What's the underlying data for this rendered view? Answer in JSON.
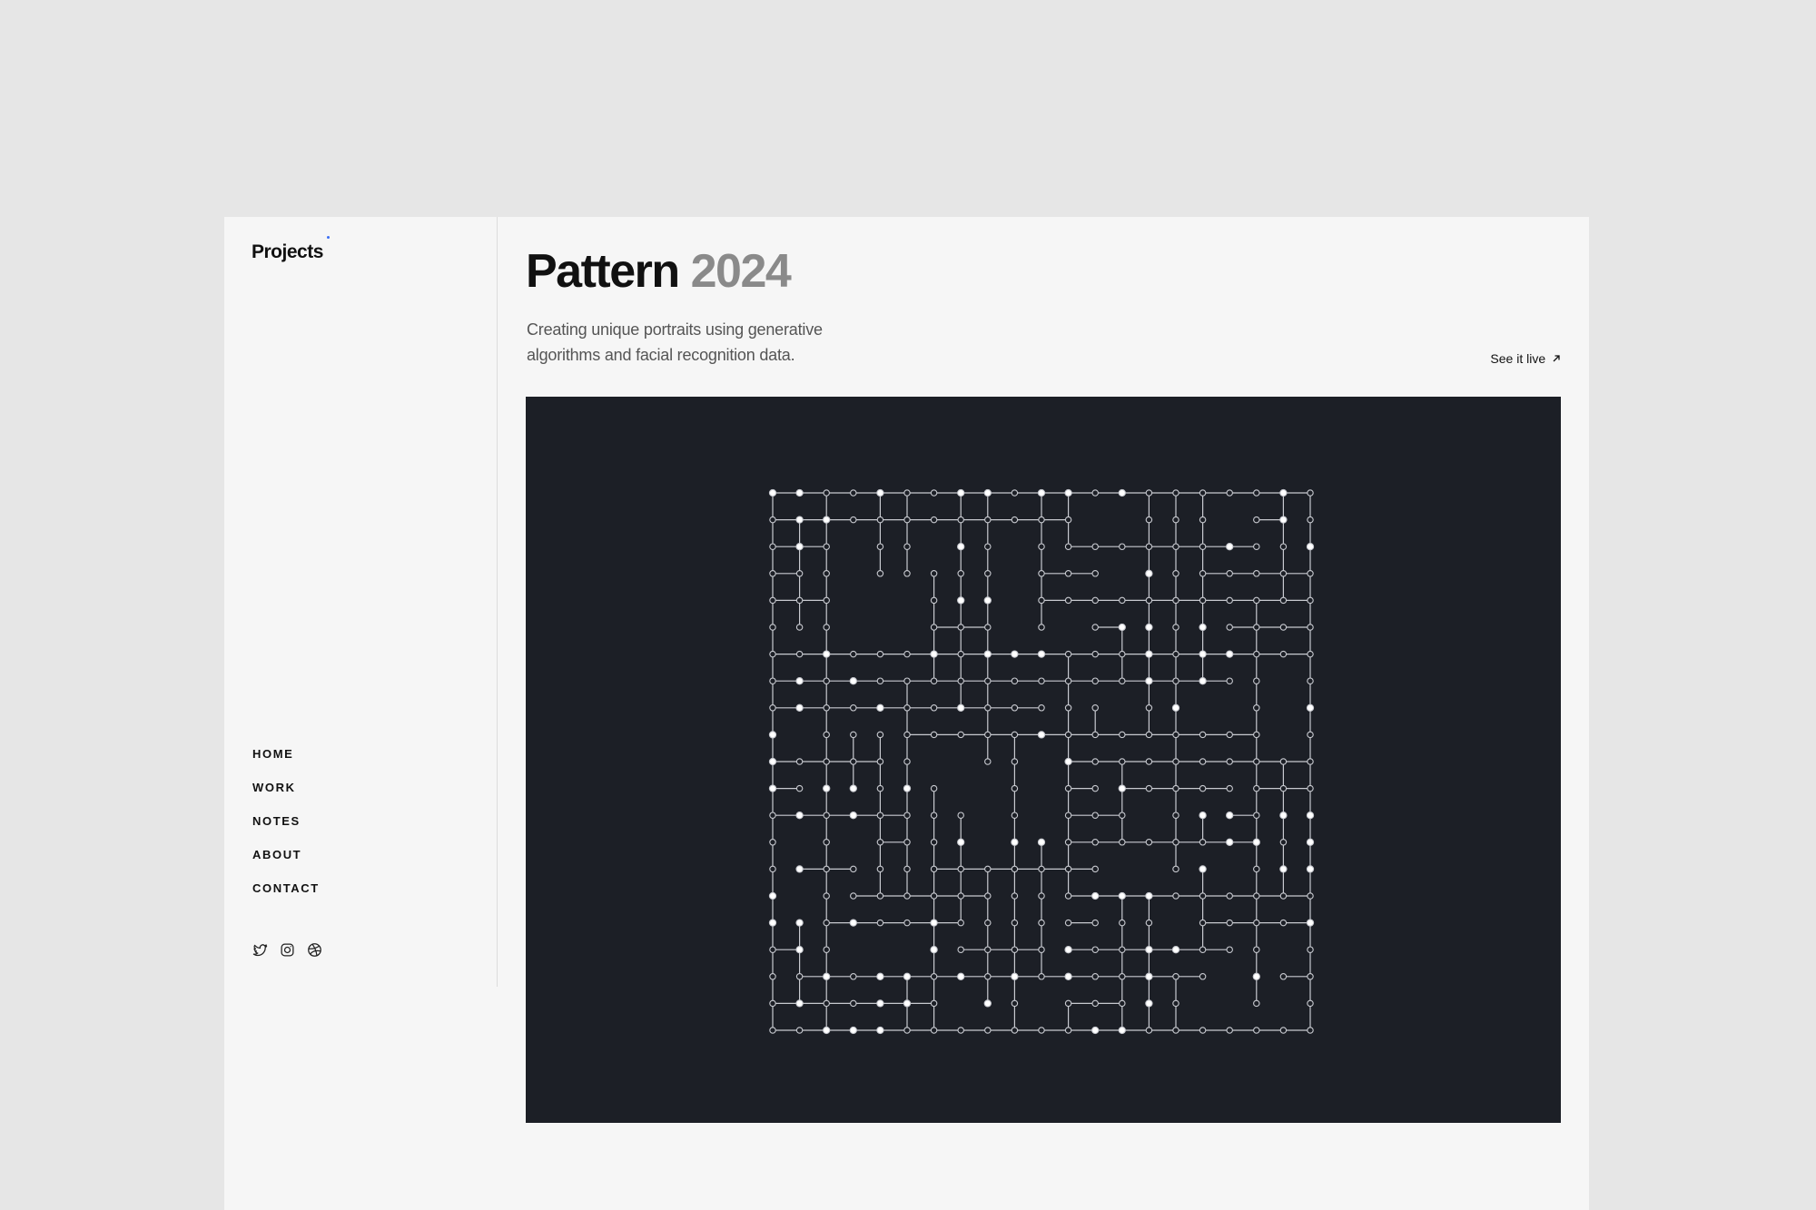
{
  "sidebar": {
    "brand": "Projects",
    "nav": [
      {
        "label": "HOME",
        "name": "nav-home"
      },
      {
        "label": "WORK",
        "name": "nav-work"
      },
      {
        "label": "NOTES",
        "name": "nav-notes"
      },
      {
        "label": "ABOUT",
        "name": "nav-about"
      },
      {
        "label": "CONTACT",
        "name": "nav-contact"
      }
    ],
    "social_icons": [
      "twitter-icon",
      "instagram-icon",
      "dribbble-icon"
    ]
  },
  "project": {
    "title": "Pattern",
    "year": "2024",
    "description": "Creating unique portraits using generative algorithms and facial recognition data.",
    "live_link": "See it live",
    "live_icon": "arrow-up-right-icon"
  },
  "colors": {
    "page_background": "#e6e6e6",
    "card_background": "#f6f6f6",
    "artwork_background": "#1c1f26",
    "artwork_lines": "#c8cad0",
    "accent_dot": "#3b6ef5"
  }
}
